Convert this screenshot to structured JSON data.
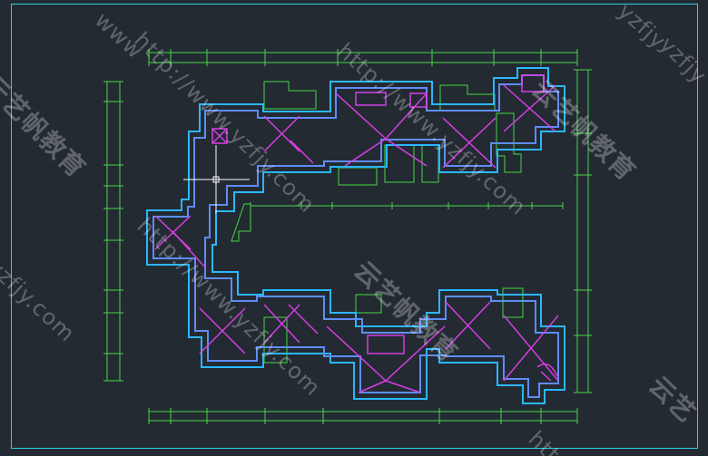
{
  "colors": {
    "background": "#232a32",
    "frame": "#2fd0e0",
    "outer_wall": "#2bb7ff",
    "inner_wall": "#5f8df5",
    "roof": "#d53ee3",
    "green": "#43d843",
    "dimension": "#49d649",
    "crosshair": "#ffffff"
  },
  "watermarks": {
    "items": [
      {
        "text": "yzfjy",
        "kind": "latin"
      },
      {
        "text": "www",
        "kind": "latin"
      },
      {
        "text": "http://www.yzfjy.com",
        "kind": "latin"
      },
      {
        "text": "云艺帆教育",
        "kind": "cn"
      },
      {
        "text": "yzfjy",
        "kind": "latin"
      },
      {
        "text": "云艺帆教育",
        "kind": "cn"
      },
      {
        "text": "http://www.yzfjy.com",
        "kind": "latin"
      },
      {
        "text": "云艺帆教育",
        "kind": "cn"
      },
      {
        "text": "http://www.yzfjy.com",
        "kind": "latin"
      },
      {
        "text": "yzfjy.com",
        "kind": "latin"
      },
      {
        "text": "云艺",
        "kind": "cn"
      },
      {
        "text": "htt",
        "kind": "latin"
      }
    ]
  }
}
